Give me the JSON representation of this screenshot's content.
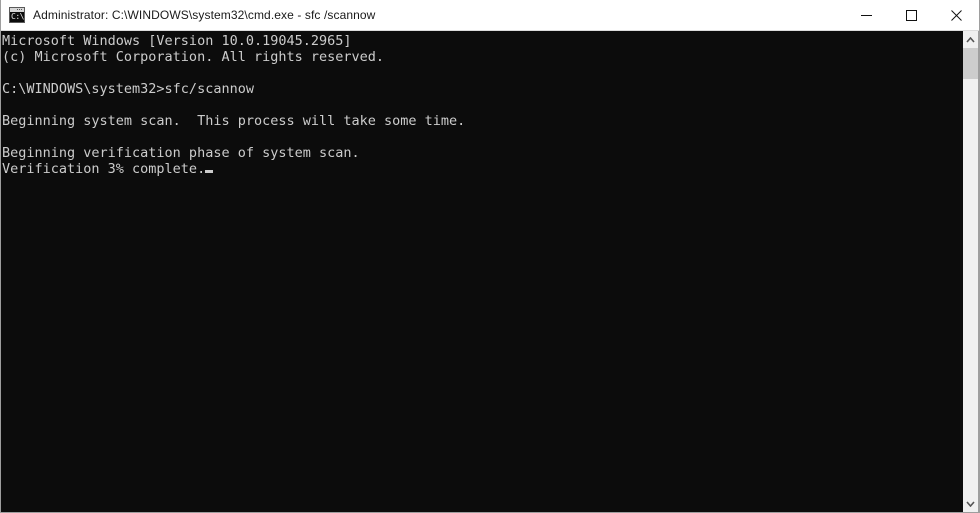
{
  "window": {
    "title": "Administrator: C:\\WINDOWS\\system32\\cmd.exe - sfc /scannow",
    "icon_name": "cmd-icon",
    "icon_glyph": "C:\\_",
    "background_color": "#0c0c0c",
    "titlebar_color": "#ffffff",
    "text_color": "#cccccc"
  },
  "controls": {
    "minimize_label": "Minimize",
    "maximize_label": "Maximize",
    "close_label": "Close"
  },
  "console": {
    "lines": [
      "Microsoft Windows [Version 10.0.19045.2965]",
      "(c) Microsoft Corporation. All rights reserved.",
      "",
      "C:\\WINDOWS\\system32>sfc/scannow",
      "",
      "Beginning system scan.  This process will take some time.",
      "",
      "Beginning verification phase of system scan.",
      "Verification 3% complete."
    ],
    "version": "10.0.19045.2965",
    "prompt_path": "C:\\WINDOWS\\system32>",
    "command": "sfc/scannow",
    "progress_percent": "3%",
    "cursor_visible": true
  },
  "scrollbar": {
    "up_arrow_name": "scroll-up-arrow",
    "down_arrow_name": "scroll-down-arrow",
    "thumb_name": "scrollbar-thumb"
  }
}
